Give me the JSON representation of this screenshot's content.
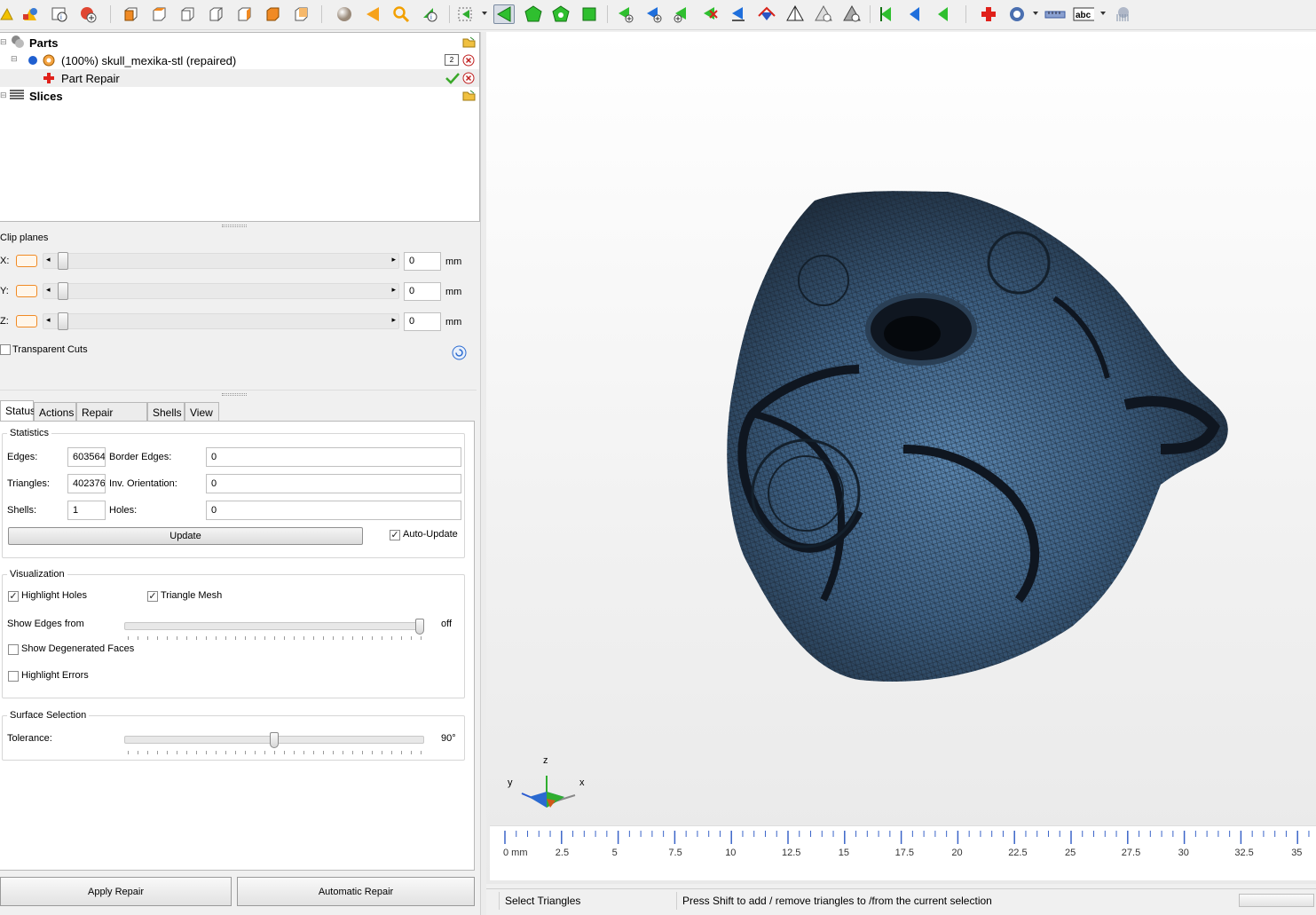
{
  "tree": {
    "parts_label": "Parts",
    "part_name": "(100%) skull_mexika-stl (repaired)",
    "part_badge": "2",
    "repair_label": "Part Repair",
    "slices_label": "Slices"
  },
  "clip": {
    "title": "Clip planes",
    "x_label": "X:",
    "y_label": "Y:",
    "z_label": "Z:",
    "x_value": "0",
    "y_value": "0",
    "z_value": "0",
    "unit": "mm",
    "transparent_label": "Transparent Cuts"
  },
  "tabs": [
    "Status",
    "Actions",
    "Repair Scripts",
    "Shells",
    "View"
  ],
  "statistics": {
    "title": "Statistics",
    "edges_label": "Edges:",
    "edges_value": "603564",
    "triangles_label": "Triangles:",
    "triangles_value": "402376",
    "shells_label": "Shells:",
    "shells_value": "1",
    "border_label": "Border Edges:",
    "border_value": "0",
    "inv_label": "Inv. Orientation:",
    "inv_value": "0",
    "holes_label": "Holes:",
    "holes_value": "0",
    "update_label": "Update",
    "auto_update_label": "Auto-Update"
  },
  "visualization": {
    "title": "Visualization",
    "highlight_holes": "Highlight Holes",
    "triangle_mesh": "Triangle Mesh",
    "show_edges_label": "Show Edges from",
    "show_edges_value": "off",
    "degenerated_label": "Show Degenerated Faces",
    "errors_label": "Highlight Errors"
  },
  "surface": {
    "title": "Surface Selection",
    "tolerance_label": "Tolerance:",
    "tolerance_value": "90°"
  },
  "buttons": {
    "apply_repair": "Apply Repair",
    "automatic_repair": "Automatic Repair"
  },
  "axis": {
    "z": "z",
    "y": "y",
    "x": "x"
  },
  "ruler": {
    "labels": [
      "0 mm",
      "2.5",
      "5",
      "7.5",
      "10",
      "12.5",
      "15",
      "17.5",
      "20",
      "22.5",
      "25",
      "27.5",
      "30",
      "32.5",
      "35"
    ]
  },
  "status": {
    "mode": "Select Triangles",
    "hint": "Press Shift to add / remove triangles to /from the current selection"
  },
  "toolbar_icons": [
    "new-part-icon",
    "add-primitive-icon",
    "part-info-icon",
    "add-part-icon",
    "view-front-icon",
    "view-back-icon",
    "view-left-icon",
    "view-right-icon",
    "view-top-icon",
    "view-bottom-icon",
    "view-iso-icon",
    "sphere-render-icon",
    "triangle-orange-icon",
    "zoom-icon",
    "measure-info-icon",
    "select-dropdown-icon",
    "select-triangle-icon",
    "select-surface-icon",
    "select-shell-icon",
    "select-all-icon",
    "add-triangle-icon",
    "add-triangle-blue-icon",
    "add-triangle-plus-icon",
    "remove-triangle-icon",
    "flip-triangle-icon",
    "cut-icon",
    "tetra-icon",
    "tetra-remove-icon",
    "tetra-gray-icon",
    "arrow-green-icon",
    "arrow-blue-icon",
    "arrow-green-2-icon",
    "repair-cross-icon",
    "rotate-icon",
    "ruler-icon",
    "text-abc-icon",
    "sphere-mesh-icon"
  ]
}
